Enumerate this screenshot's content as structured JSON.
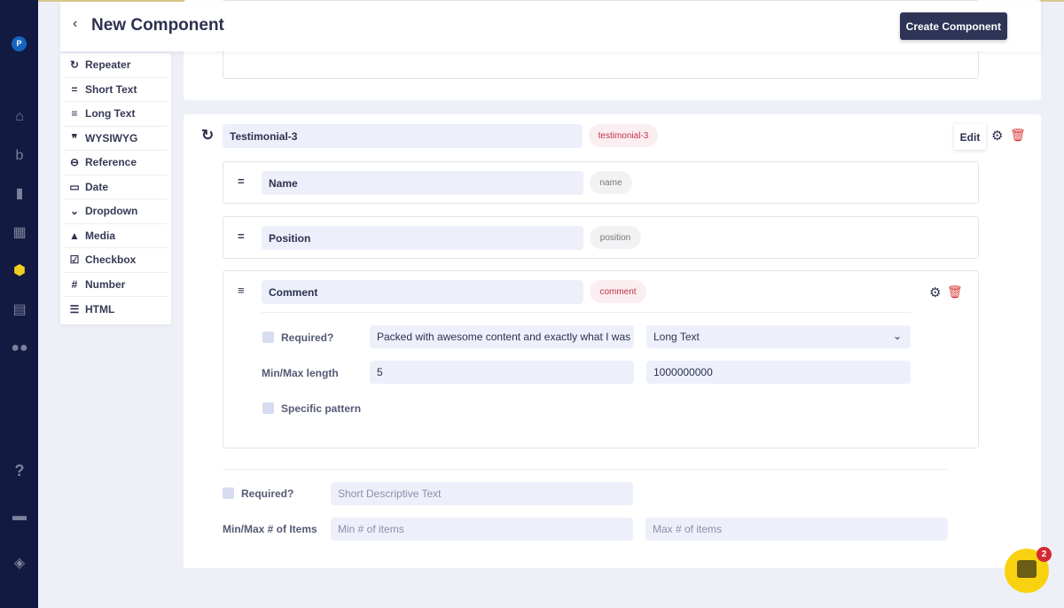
{
  "header": {
    "title": "New Component",
    "back_icon": "chevron-left-icon",
    "create_label": "Create Component"
  },
  "nav": {
    "avatar_letter": "P",
    "icons": [
      "home-icon",
      "blog-icon",
      "page-icon",
      "table-icon",
      "components-icon",
      "media-icon",
      "users-icon",
      "help-icon",
      "book-icon",
      "layers-icon"
    ],
    "active": "components-icon",
    "active_color": "#f2cf1f"
  },
  "palette": {
    "items": [
      {
        "label": "Repeater",
        "icon": "repeat-icon"
      },
      {
        "label": "Short Text",
        "icon": "short-text-icon"
      },
      {
        "label": "Long Text",
        "icon": "long-text-icon"
      },
      {
        "label": "WYSIWYG",
        "icon": "quote-icon"
      },
      {
        "label": "Reference",
        "icon": "link-icon"
      },
      {
        "label": "Date",
        "icon": "calendar-icon"
      },
      {
        "label": "Dropdown",
        "icon": "chevron-down-icon"
      },
      {
        "label": "Media",
        "icon": "image-icon"
      },
      {
        "label": "Checkbox",
        "icon": "checkbox-icon"
      },
      {
        "label": "Number",
        "icon": "hash-icon"
      },
      {
        "label": "HTML",
        "icon": "list-icon"
      }
    ]
  },
  "repeater": {
    "name": "Testimonial-3",
    "slug": "testimonial-3",
    "edit_label": "Edit",
    "fields": [
      {
        "name": "Name",
        "slug": "name"
      },
      {
        "name": "Position",
        "slug": "position"
      },
      {
        "name": "Comment",
        "slug": "comment"
      }
    ],
    "comment_settings": {
      "required_label": "Required?",
      "default_value": "Packed with awesome content and exactly what I was l",
      "type_value": "Long Text",
      "minmax_label": "Min/Max length",
      "min": "5",
      "max": "1000000000",
      "pattern_label": "Specific pattern"
    },
    "footer": {
      "required_label": "Required?",
      "desc_placeholder": "Short Descriptive Text",
      "items_label": "Min/Max # of Items",
      "min_placeholder": "Min # of items",
      "max_placeholder": "Max # of items"
    }
  },
  "chat": {
    "badge": "2",
    "color": "#f8d20f"
  },
  "colors": {
    "nav_bg": "#121a42",
    "accent_button": "#2f3457",
    "delete": "#d9383a"
  }
}
